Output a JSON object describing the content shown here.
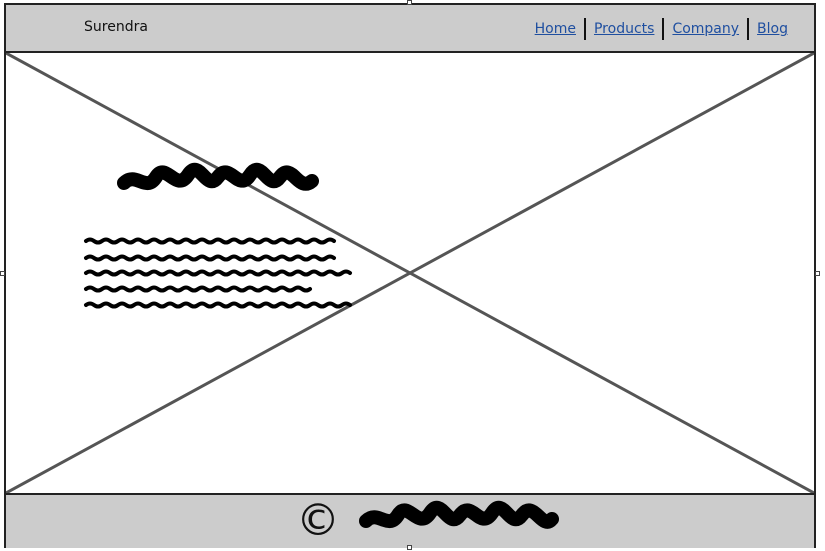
{
  "header": {
    "brand": "Surendra",
    "nav": [
      {
        "label": "Home"
      },
      {
        "label": "Products"
      },
      {
        "label": "Company"
      },
      {
        "label": "Blog"
      }
    ]
  },
  "hero": {
    "placeholder": "image-placeholder",
    "heading_scribble": "scribble",
    "paragraph_lines": 5
  },
  "footer": {
    "copyright_symbol": "©"
  },
  "colors": {
    "bar_bg": "#cccccc",
    "link": "#1f4fa0",
    "placeholder_lines": "#555555"
  }
}
